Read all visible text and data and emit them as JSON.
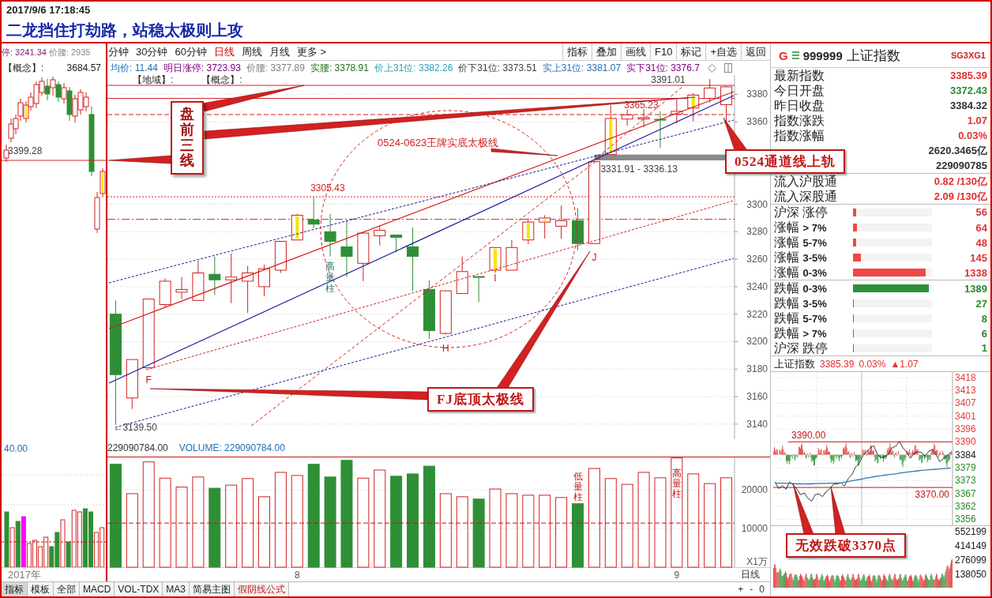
{
  "header": {
    "datetime": "2017/9/6 17:18:45",
    "title": "二龙挡住打劫路，站稳太极则上攻"
  },
  "left_panel": {
    "limit_price": "停: 3241.34",
    "waist_price": "价腰: 2935",
    "concept": "【概念】:",
    "price_label": "3684.57",
    "level_label": "3399.28",
    "volume_scale": "40.00"
  },
  "periods": [
    {
      "label": "分钟",
      "selected": false
    },
    {
      "label": "30分钟",
      "selected": false
    },
    {
      "label": "60分钟",
      "selected": false
    },
    {
      "label": "日线",
      "selected": true
    },
    {
      "label": "周线",
      "selected": false
    },
    {
      "label": "月线",
      "selected": false
    },
    {
      "label": "更多 >",
      "selected": false
    }
  ],
  "toolbar_buttons": [
    "指标",
    "叠加",
    "画线",
    "F10",
    "标记",
    "+自选",
    "返回"
  ],
  "info": [
    {
      "text": "均价: 11.44",
      "color": "#1f6fb5"
    },
    {
      "text": "明日涨停: 3723.93",
      "color": "#800080"
    },
    {
      "text": "价腰: 3377.89",
      "color": "#808080"
    },
    {
      "text": "实腰: 3378.91",
      "color": "#207020"
    },
    {
      "text": "价上31位: 3382.26",
      "color": "#2aa0b4"
    },
    {
      "text": "价下31位: 3373.51",
      "color": "#404040"
    },
    {
      "text": "实上31位: 3381.07",
      "color": "#1f6fb5"
    },
    {
      "text": "实下31位: 3376.7",
      "color": "#800080"
    }
  ],
  "tags": [
    "【地域】:",
    "【概念】:"
  ],
  "kline": {
    "candle_marks": [
      false,
      false,
      false,
      false,
      false,
      false,
      false,
      false,
      false,
      false,
      false,
      true,
      false,
      false,
      false,
      false,
      false,
      false,
      false,
      false,
      false,
      false,
      false,
      true,
      false,
      true,
      true,
      false,
      false,
      false,
      true,
      false,
      false,
      false,
      false,
      true,
      false,
      false
    ],
    "chart_data": [
      {
        "type": "candlestick",
        "ylim": [
          3129,
          3394
        ],
        "yticks": [
          3140,
          3160,
          3180,
          3200,
          3220,
          3240,
          3260,
          3280,
          3300,
          3360,
          3380
        ],
        "grid": true,
        "ohlc": [
          [
            3220,
            3230,
            3139.5,
            3176
          ],
          [
            3159,
            3187,
            3151,
            3187
          ],
          [
            3181,
            3231,
            3181,
            3231
          ],
          [
            3227,
            3246,
            3225,
            3244
          ],
          [
            3236,
            3247,
            3231,
            3238
          ],
          [
            3230,
            3259,
            3230,
            3250
          ],
          [
            3249,
            3262,
            3234,
            3245
          ],
          [
            3245,
            3264,
            3228,
            3247
          ],
          [
            3244,
            3255,
            3221,
            3250
          ],
          [
            3240,
            3256,
            3233,
            3253
          ],
          [
            3252,
            3273,
            3250,
            3273
          ],
          [
            3274,
            3293,
            3274,
            3292
          ],
          [
            3288.5,
            3305.43,
            3282.6,
            3285.5
          ],
          [
            3280,
            3293,
            3262,
            3273
          ],
          [
            3269,
            3288,
            3247,
            3262
          ],
          [
            3257,
            3280,
            3244,
            3279
          ],
          [
            3277,
            3284,
            3270,
            3281
          ],
          [
            3277.6,
            3277.6,
            3265,
            3275.9
          ],
          [
            3269,
            3283,
            3237,
            3262
          ],
          [
            3238,
            3244.5,
            3202,
            3208
          ],
          [
            3206,
            3237,
            3205,
            3237
          ],
          [
            3235,
            3262,
            3235,
            3251
          ],
          [
            3247.4,
            3247.4,
            3229,
            3246.8
          ],
          [
            3252,
            3268.5,
            3250,
            3268.5
          ],
          [
            3252,
            3274,
            3252,
            3268.5
          ],
          [
            3274,
            3290,
            3271,
            3287
          ],
          [
            3287,
            3292,
            3275,
            3290
          ],
          [
            3284,
            3299,
            3275,
            3288
          ],
          [
            3288,
            3297,
            3266.5,
            3271.4
          ],
          [
            3271.4,
            3331.91,
            3271,
            3331
          ],
          [
            3336.13,
            3372,
            3336.13,
            3362.4
          ],
          [
            3362,
            3375,
            3357,
            3365
          ],
          [
            3362,
            3373.5,
            3356,
            3363
          ],
          [
            3361.8,
            3367.6,
            3341,
            3361.2
          ],
          [
            3365.6,
            3376.5,
            3358.8,
            3367.6
          ],
          [
            3370,
            3380.8,
            3360.3,
            3379.4
          ],
          [
            3377,
            3391.01,
            3374,
            3384.6
          ],
          [
            3372.43,
            3386,
            3360.3,
            3385.39
          ]
        ],
        "ref_lines": [
          {
            "axis": "y",
            "value": 3386.5,
            "color": "#d42020",
            "line_style": "solid"
          },
          {
            "axis": "y",
            "value": 3377,
            "color": "#d42020",
            "line_style": "solid"
          },
          {
            "axis": "y",
            "value": 3365.23,
            "color": "#d42020",
            "line_style": "dashed"
          },
          {
            "axis": "y",
            "value": 3305.43,
            "color": "#d42020",
            "line_style": "dotted"
          },
          {
            "axis": "y",
            "value": 3289,
            "color": "#d42020",
            "line_style": "dashdot"
          }
        ],
        "bands": [
          {
            "axis": "y",
            "from": 3331.91,
            "to": 3336.13,
            "label": "3331.91 - 3336.13",
            "color": "#8a8a8a"
          }
        ],
        "annotations": [
          "3391.01",
          "3365.23",
          "3305.43",
          "←3139.50",
          "F",
          "H",
          "I",
          "J",
          "高量柱"
        ]
      }
    ]
  },
  "volume": {
    "header": [
      "229090784.00",
      "VOLUME: 229090784.00"
    ],
    "chart_data": [
      {
        "type": "bar",
        "ylim": [
          0,
          28370
        ],
        "yticks": [
          10000,
          20000
        ],
        "ylabel": "X1万",
        "grid": true,
        "categories": [
          null,
          null,
          null,
          null,
          null,
          null,
          null,
          null,
          null,
          null,
          null,
          "8",
          null,
          null,
          null,
          null,
          null,
          null,
          null,
          null,
          null,
          null,
          null,
          null,
          null,
          null,
          null,
          null,
          null,
          null,
          null,
          null,
          null,
          null,
          "9",
          null,
          null,
          null
        ],
        "values": [
          26600,
          19000,
          27200,
          23000,
          20700,
          23300,
          20400,
          21200,
          22900,
          18200,
          24500,
          23700,
          26600,
          23300,
          27600,
          23000,
          25100,
          23500,
          24100,
          26100,
          19000,
          18200,
          17600,
          20200,
          19000,
          18600,
          18600,
          18000,
          16400,
          25500,
          22900,
          21400,
          24500,
          23100,
          28200,
          24100,
          21600,
          23100
        ],
        "colors": [
          "#2f8f36",
          "#d42020",
          "#d42020",
          "#d42020",
          "#d42020",
          "#d42020",
          "#2f8f36",
          "#d42020",
          "#d42020",
          "#d42020",
          "#d42020",
          "#d42020",
          "#2f8f36",
          "#2f8f36",
          "#2f8f36",
          "#d42020",
          "#d42020",
          "#2f8f36",
          "#2f8f36",
          "#2f8f36",
          "#d42020",
          "#d42020",
          "#2f8f36",
          "#d42020",
          "#d42020",
          "#d42020",
          "#d42020",
          "#d42020",
          "#2f8f36",
          "#d42020",
          "#d42020",
          "#d42020",
          "#d42020",
          "#d42020",
          "#d42020",
          "#d42020",
          "#d42020",
          "#d42020"
        ],
        "ref_lines": [
          {
            "axis": "y",
            "value": 11400,
            "color": "#c01818",
            "line_style": "dashed"
          }
        ],
        "annotations": [
          "低量柱",
          "高量柱"
        ]
      }
    ]
  },
  "x_axis": {
    "year": "2017年",
    "period": "日线"
  },
  "bottom_tabs": [
    {
      "label": "指标",
      "selected": true,
      "kind": "tab"
    },
    {
      "label": "模板",
      "selected": false,
      "kind": "tab"
    },
    {
      "label": "全部",
      "selected": false,
      "kind": "tab"
    },
    {
      "label": "MACD",
      "selected": false,
      "kind": "tab"
    },
    {
      "label": "VOL-TDX",
      "selected": false,
      "kind": "tab"
    },
    {
      "label": "MA3",
      "selected": false,
      "kind": "tab"
    },
    {
      "label": "简易主图",
      "selected": false,
      "kind": "tab"
    },
    {
      "label": "假阴线公式",
      "selected": false,
      "kind": "formula"
    }
  ],
  "zoom_buttons": [
    "+",
    "-",
    "0"
  ],
  "quote": {
    "marker": "G",
    "code": "999999",
    "name": "上证指数",
    "tag": "SG3XG1"
  },
  "stats": [
    {
      "label": "最新指数",
      "value": "3385.39",
      "color": "#e03030"
    },
    {
      "label": "今日开盘",
      "value": "3372.43",
      "color": "#2a8a2a"
    },
    {
      "label": "昨日收盘",
      "value": "3384.32",
      "color": "#303030"
    },
    {
      "label": "指数涨跌",
      "value": "1.07",
      "color": "#e03030"
    },
    {
      "label": "指数涨幅",
      "value": "0.03%",
      "color": "#e03030"
    },
    {
      "value": "2620.3465亿",
      "color": "#303030"
    },
    {
      "value": "229090785",
      "color": "#303030"
    }
  ],
  "connect": [
    {
      "label": "流入沪股通",
      "value": "0.82 /130亿"
    },
    {
      "label": "流入深股通",
      "value": "2.09 /130亿"
    }
  ],
  "breadth_up": [
    {
      "label": "沪深 涨停",
      "level": 0.04,
      "count": "56"
    },
    {
      "label": "涨幅 **> 7%**",
      "level": 0.05,
      "count": "64"
    },
    {
      "label": "涨幅 **5-7%**",
      "level": 0.04,
      "count": "48"
    },
    {
      "label": "涨幅 **3-5%**",
      "level": 0.1,
      "count": "145"
    },
    {
      "label": "涨幅 **0-3%**",
      "level": 0.92,
      "count": "1338"
    }
  ],
  "breadth_down": [
    {
      "label": "跌幅 **0-3%**",
      "level": 0.96,
      "count": "1389"
    },
    {
      "label": "跌幅 **3-5%**",
      "level": 0.01,
      "count": "27"
    },
    {
      "label": "跌幅 **5-7%**",
      "level": 0.01,
      "count": "8"
    },
    {
      "label": "跌幅 **> 7%**",
      "level": 0.01,
      "count": "6"
    },
    {
      "label": "沪深 跌停",
      "level": 0.01,
      "count": "1"
    }
  ],
  "index_summary": {
    "name": "上证指数",
    "price": "3385.39",
    "change_pct": "0.03%",
    "change": "▲1.07"
  },
  "intraday": {
    "chart_data": [
      {
        "type": "line",
        "categories": [
          null,
          null,
          null,
          null,
          null,
          null,
          null,
          null,
          null,
          null,
          null,
          null,
          null,
          null,
          null,
          null,
          null,
          null,
          null,
          null,
          null,
          null,
          null,
          null,
          null,
          null,
          null,
          null,
          null,
          null,
          null,
          null,
          null,
          null,
          null,
          null,
          null,
          null,
          null,
          null,
          null,
          null,
          null,
          null,
          null,
          null,
          null,
          null,
          null
        ],
        "series": [
          {
            "color": "#202020",
            "values": [
              3372.4,
              3369.5,
              3370.8,
              3369.2,
              3372.4,
              3371.0,
              3369.3,
              3366.8,
              3367.6,
              3365.2,
              3364.0,
              3366.9,
              3367.1,
              3366.0,
              3368.3,
              3369.5,
              3371.4,
              3371.6,
              3372.0,
              3370.6,
              3373.9,
              3375.6,
              3378.9,
              3380.6,
              3383.9,
              3385.6,
              3387.4,
              3388.3,
              3384.3,
              3383.1,
              3383.4,
              3384.6,
              3387.4,
              3388.1,
              3390.2,
              3387.1,
              3385.5,
              3382.8,
              3384.9,
              3385.6,
              3385.4,
              3383.7,
              3385.9,
              3386.6,
              3384.4,
              3381.3,
              3382.7,
              3383.8,
              3385.4
            ]
          },
          {
            "color": "#2a7ab8",
            "values": [
              3372,
              3371.9,
              3371.9,
              3371.8,
              3371.8,
              3371.7,
              3371.6,
              3371.6,
              3371.5,
              3371.6,
              3371.6,
              3371.7,
              3371.7,
              3371.8,
              3371.8,
              3371.9,
              3371.9,
              3372,
              3372,
              3372.3,
              3372.6,
              3372.9,
              3373.2,
              3373.5,
              3373.8,
              3374.1,
              3374.4,
              3374.7,
              3375,
              3375.2,
              3375.4,
              3375.6,
              3375.8,
              3376,
              3376.3,
              3376.5,
              3376.7,
              3376.9,
              3377.1,
              3377.3,
              3377.5,
              3377.6,
              3377.8,
              3377.9,
              3378,
              3378.1,
              3378.3,
              3378.4,
              3378.5
            ]
          }
        ],
        "ylim": [
          3353.4,
          3420.6
        ],
        "yticks": [
          {
            "value": 3418.22,
            "label": "3418"
          },
          {
            "value": 3412.57,
            "label": "3413"
          },
          {
            "value": 3406.92,
            "label": "3407"
          },
          {
            "value": 3401.27,
            "label": "3401"
          },
          {
            "value": 3395.62,
            "label": "3396"
          },
          {
            "value": 3389.97,
            "label": "3390"
          },
          {
            "value": 3384.32,
            "label": "3384"
          },
          {
            "value": 3378.67,
            "label": "3379"
          },
          {
            "value": 3373.02,
            "label": "3373"
          },
          {
            "value": 3367.37,
            "label": "3367"
          },
          {
            "value": 3361.72,
            "label": "3362"
          },
          {
            "value": 3356.07,
            "label": "3356"
          }
        ],
        "grid": true,
        "ref_lines": [
          {
            "axis": "y",
            "value": 3390,
            "label": "3390.00",
            "color": "#c01818",
            "line_style": "solid"
          },
          {
            "axis": "y",
            "value": 3370,
            "label": "3370.00",
            "color": "#c01818",
            "line_style": "solid"
          }
        ]
      }
    ],
    "volume_scale": [
      "552199",
      "414149",
      "276099",
      "138050"
    ]
  },
  "callouts": [
    {
      "kind": "vertical",
      "text": "盘前三线"
    },
    {
      "kind": "plain",
      "text": "0524-0623王牌实底太极线"
    },
    {
      "kind": "box",
      "text": "0524通道线上轨"
    },
    {
      "kind": "box",
      "text": "FJ底顶太极线"
    },
    {
      "kind": "box",
      "text": "无效跌破3370点"
    }
  ]
}
